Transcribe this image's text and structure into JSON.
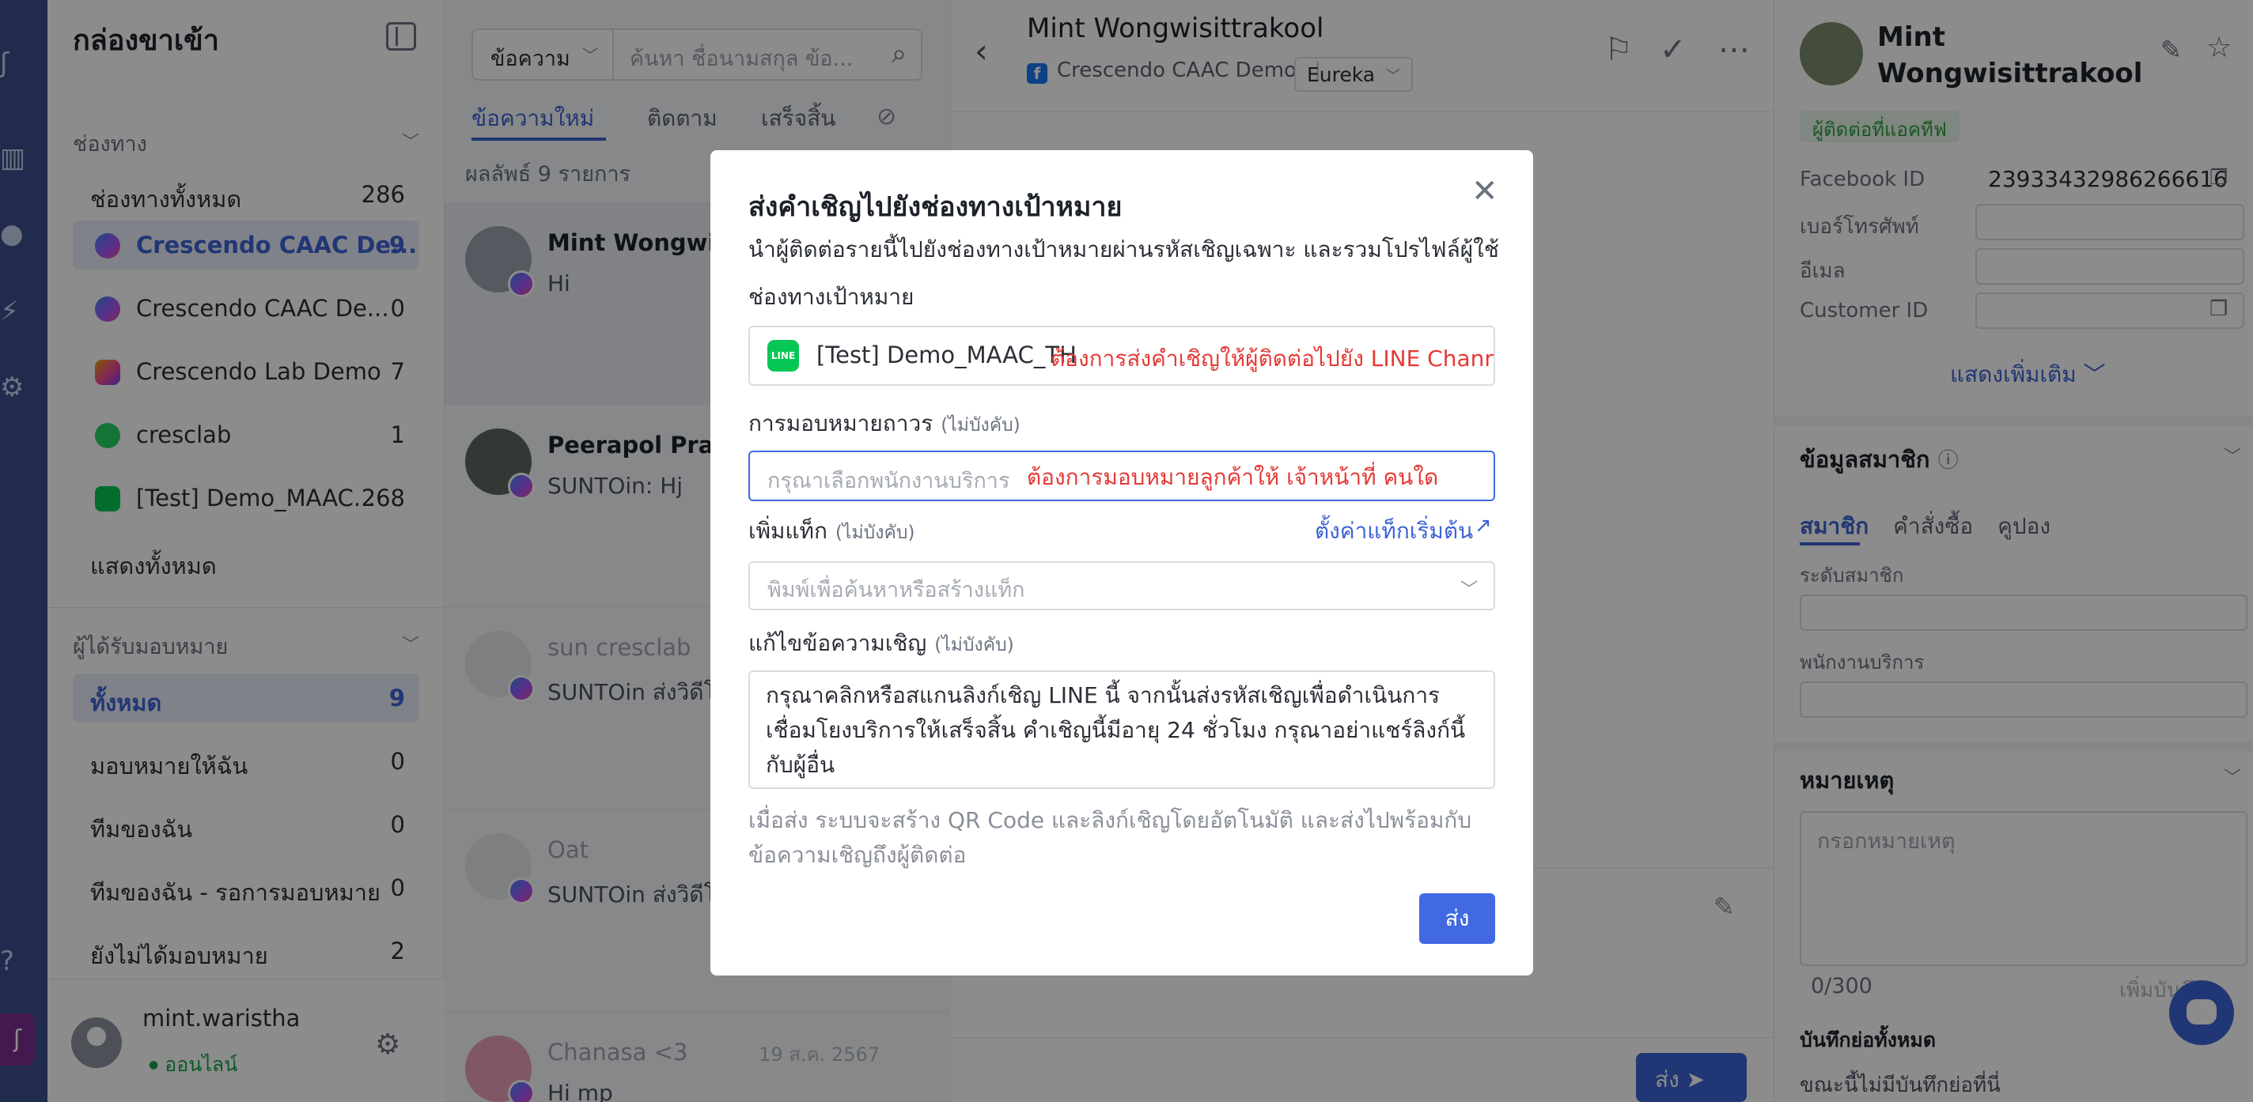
{
  "inbox": {
    "title": "กล่องขาเข้า",
    "channels_section": "ช่องทาง",
    "channels": [
      {
        "label": "ช่องทางทั้งหมด",
        "count": "286",
        "icon": "none"
      },
      {
        "label": "Crescendo CAAC De...",
        "count": "9",
        "icon": "messenger-icon"
      },
      {
        "label": "Crescendo CAAC De...",
        "count": "0",
        "icon": "messenger-icon"
      },
      {
        "label": "Crescendo Lab Demo",
        "count": "7",
        "icon": "instagram-icon"
      },
      {
        "label": "cresclab",
        "count": "1",
        "icon": "whatsapp-icon"
      },
      {
        "label": "[Test] Demo_MAAC...",
        "count": "268",
        "icon": "line-icon"
      }
    ],
    "show_all": "แสดงทั้งหมด",
    "assignee_section": "ผู้ได้รับมอบหมาย",
    "assignees": [
      {
        "label": "ทั้งหมด",
        "count": "9"
      },
      {
        "label": "มอบหมายให้ฉัน",
        "count": "0"
      },
      {
        "label": "ทีมของฉัน",
        "count": "0"
      },
      {
        "label": "ทีมของฉัน - รอการมอบหมาย",
        "count": "0"
      },
      {
        "label": "ยังไม่ได้มอบหมาย",
        "count": "2"
      }
    ],
    "user": {
      "name": "mint.waristha",
      "status": "ออนไลน์"
    }
  },
  "conversations": {
    "search_type": "ข้อความ",
    "search_placeholder": "ค้นหา ชื่อนามสกุล ข้อ...",
    "tabs": [
      "ข้อความใหม่",
      "ติดตาม",
      "เสร็จสิ้น"
    ],
    "result_text": "ผลลัพธ์ 9 รายการ",
    "items": [
      {
        "name": "Mint Wongwisit",
        "preview": "Hi",
        "date": ""
      },
      {
        "name": "Peerapol Prakai",
        "preview": "SUNTOin: Hj",
        "date": ""
      },
      {
        "name": "sun cresclab",
        "preview": "SUNTOin ส่งวิดีโอ",
        "date": ""
      },
      {
        "name": "Oat",
        "preview": "SUNTOin ส่งวิดีโอ",
        "date": ""
      },
      {
        "name": "Chanasa <3",
        "preview": "Hi mp",
        "date": "19 ส.ค. 2567"
      }
    ]
  },
  "chat": {
    "title": "Mint Wongwisittrakool",
    "channel": "Crescendo CAAC Demo",
    "brand": "Eureka",
    "send_label": "ส่ง"
  },
  "profile": {
    "name_line1": "Mint",
    "name_line2": "Wongwisittrakool",
    "status_tag": "ผู้ติดต่อที่แอคทีฟ",
    "facebook_id_label": "Facebook ID",
    "facebook_id": "23933432986266616",
    "phone_label": "เบอร์โทรศัพท์",
    "email_label": "อีเมล",
    "customer_id_label": "Customer ID",
    "show_more": "แสดงเพิ่มเติม",
    "member_section": "ข้อมูลสมาชิก",
    "member_tabs": [
      "สมาชิก",
      "คำสั่งซื้อ",
      "คูปอง"
    ],
    "member_level_label": "ระดับสมาชิก",
    "service_staff_label": "พนักงานบริการ",
    "notes_section": "หมายเหตุ",
    "notes_placeholder": "กรอกหมายเหตุ",
    "notes_count": "0/300",
    "notes_add": "เพิ่มบันทึก",
    "all_notes_label": "บันทึกย่อทั้งหมด",
    "no_notes": "ขณะนี้ไม่มีบันทึกย่อที่นี่"
  },
  "modal": {
    "title": "ส่งคำเชิญไปยังช่องทางเป้าหมาย",
    "description": "นำผู้ติดต่อรายนี้ไปยังช่องทางเป้าหมายผ่านรหัสเชิญเฉพาะ และรวมโปรไฟล์ผู้ใช้",
    "target_label": "ช่องทางเป้าหมาย",
    "target_value": "[Test] Demo_MAAC_TH",
    "target_annotation": "ต้องการส่งคำเชิญให้ผู้ติดต่อไปยัง LINE Channel ใด",
    "assign_label": "การมอบหมายถาวร",
    "optional": "(ไม่บังคับ)",
    "assign_placeholder": "กรุณาเลือกพนักงานบริการ",
    "assign_annotation": "ต้องการมอบหมายลูกค้าให้ เจ้าหน้าที่ คนใด",
    "tag_label": "เพิ่มแท็ก",
    "tag_link": "ตั้งค่าแท็กเริ่มต้น",
    "tag_placeholder": "พิมพ์เพื่อค้นหาหรือสร้างแท็ก",
    "message_label": "แก้ไขข้อความเชิญ",
    "message_text": "กรุณาคลิกหรือสแกนลิงก์เชิญ LINE นี้ จากนั้นส่งรหัสเชิญเพื่อดำเนินการเชื่อมโยงบริการให้เสร็จสิ้น คำเชิญนี้มีอายุ 24 ชั่วโมง กรุณาอย่าแชร์ลิงก์นี้กับผู้อื่น",
    "note": "เมื่อส่ง ระบบจะสร้าง QR Code และลิงก์เชิญโดยอัตโนมัติ และส่งไปพร้อมกับข้อความเชิญถึงผู้ติดต่อ",
    "send": "ส่ง"
  },
  "colors": {
    "primary": "#3c63d4",
    "annotation": "#e53935",
    "line_green": "#06c755",
    "rail": "#3d4f8c"
  }
}
